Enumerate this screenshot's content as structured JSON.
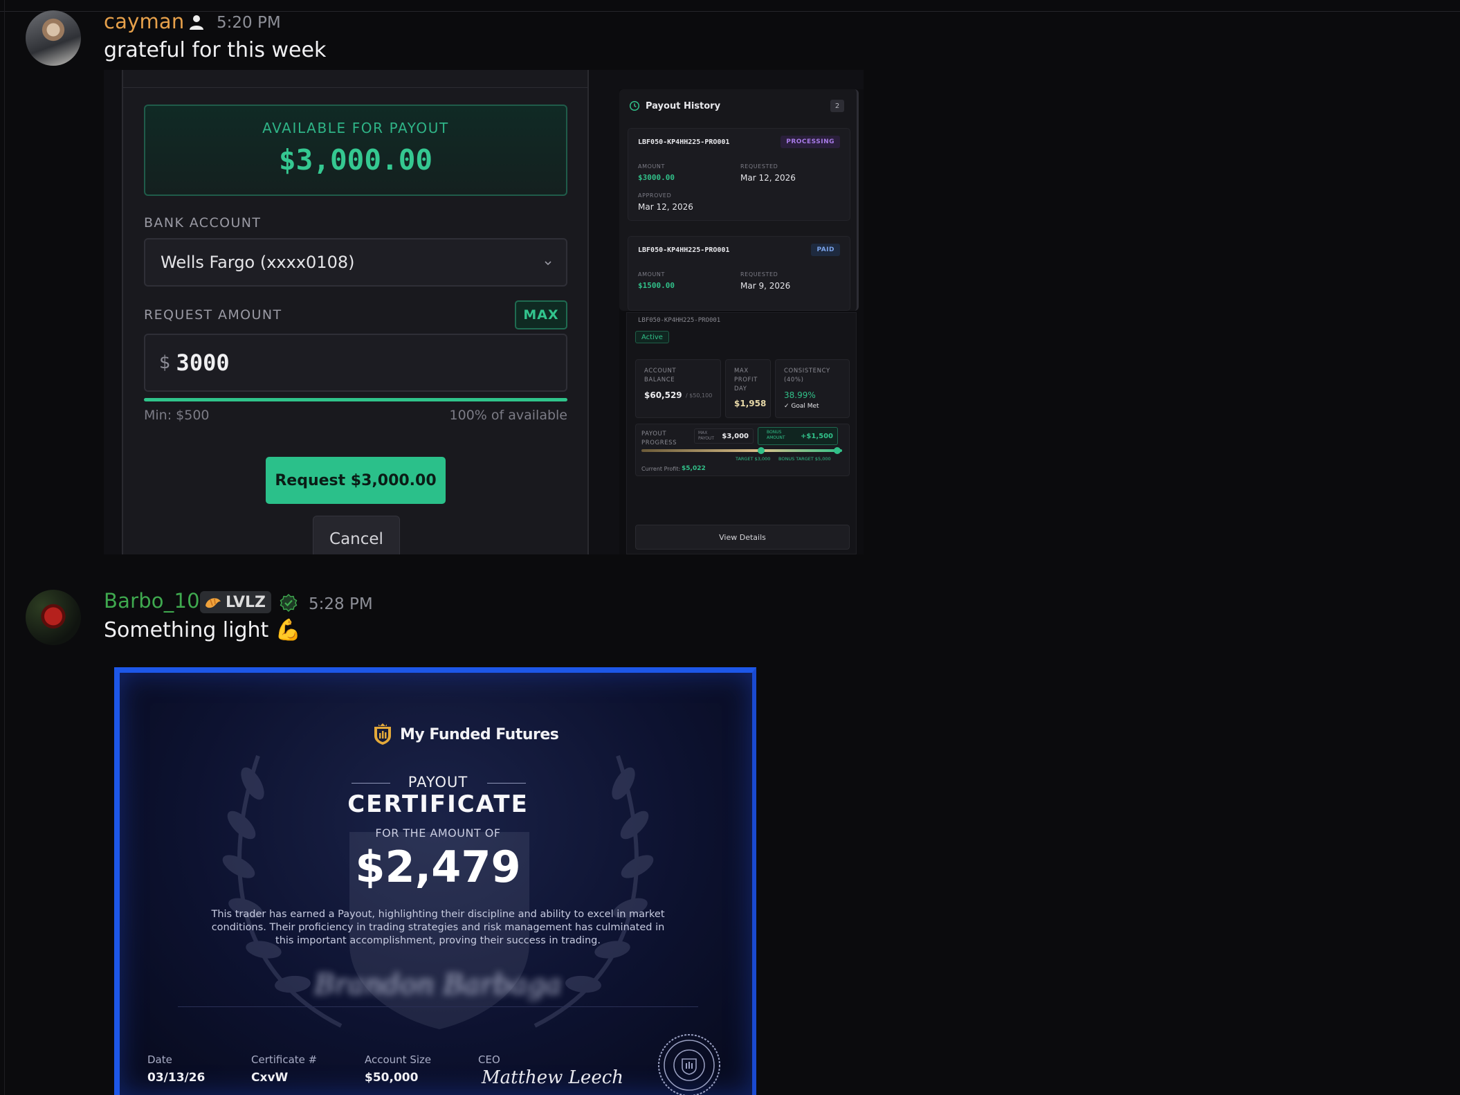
{
  "messages": [
    {
      "username": "cayman",
      "username_color": "#e7a14b",
      "time": "5:20 PM",
      "text": "grateful for this week",
      "icon": "user-icon"
    },
    {
      "username": "Barbo_10",
      "username_color": "#3fa94f",
      "badge_label": "LVLZ",
      "badge_icon": "croissant-icon",
      "time": "5:28 PM",
      "text": "Something light 💪"
    }
  ],
  "payout_form": {
    "available_label": "AVAILABLE FOR PAYOUT",
    "available_value": "$3,000.00",
    "bank_label": "BANK ACCOUNT",
    "bank_value": "Wells Fargo (xxxx0108)",
    "request_label": "REQUEST AMOUNT",
    "max_label": "MAX",
    "currency": "$",
    "amount_value": "3000",
    "progress_fraction": 1.0,
    "min_text": "Min: $500",
    "percent_text": "100% of available",
    "request_button": "Request $3,000.00",
    "cancel_button": "Cancel"
  },
  "payout_history": {
    "title": "Payout History",
    "count": "2",
    "items": [
      {
        "id": "LBF050-KP4HH225-PRO001",
        "status": "PROCESSING",
        "amount_label": "AMOUNT",
        "amount": "$3000.00",
        "requested_label": "REQUESTED",
        "requested": "Mar 12, 2026",
        "approved_label": "APPROVED",
        "approved": "Mar 12, 2026"
      },
      {
        "id": "LBF050-KP4HH225-PRO001",
        "status": "PAID",
        "amount_label": "AMOUNT",
        "amount": "$1500.00",
        "requested_label": "REQUESTED",
        "requested": "Mar 9, 2026"
      }
    ]
  },
  "account_panel": {
    "id": "LBF050-KP4HH225-PRO001",
    "status": "Active",
    "balance_label": "ACCOUNT BALANCE",
    "balance": "$60,529",
    "balance_base": "/ $50,100",
    "max_profit_label": "MAX PROFIT DAY",
    "max_profit": "$1,958",
    "consistency_label": "CONSISTENCY (40%)",
    "consistency": "38.99%",
    "goal_text": "✓ Goal Met",
    "progress_label": "PAYOUT PROGRESS",
    "max_payout_label": "MAX PAYOUT",
    "max_payout": "$3,000",
    "bonus_label": "BONUS AMOUNT",
    "bonus": "+$1,500",
    "target_label": "TARGET $3,000",
    "bonus_target_label": "BONUS TARGET $5,000",
    "current_profit_label": "Current Profit:",
    "current_profit": "$5,022",
    "view_button": "View Details"
  },
  "certificate": {
    "brand": "My Funded Futures",
    "payout": "PAYOUT",
    "title": "CERTIFICATE",
    "for_amount": "FOR THE AMOUNT OF",
    "amount": "$2,479",
    "body": "This trader has earned a Payout, highlighting their discipline and ability to excel in market conditions. Their proficiency in trading strategies and risk management has culminated in this important accomplishment, proving their success in trading.",
    "signature_name": "Brandon Barbaga",
    "date_label": "Date",
    "date": "03/13/26",
    "cert_label": "Certificate #",
    "cert_no": "CxvW",
    "size_label": "Account Size",
    "size": "$50,000",
    "ceo_label": "CEO",
    "ceo_signature": "Matthew Leech"
  },
  "colors": {
    "background": "#0b0b0d",
    "accent_green": "#2bc08a",
    "cert_border": "#1d57e8"
  }
}
